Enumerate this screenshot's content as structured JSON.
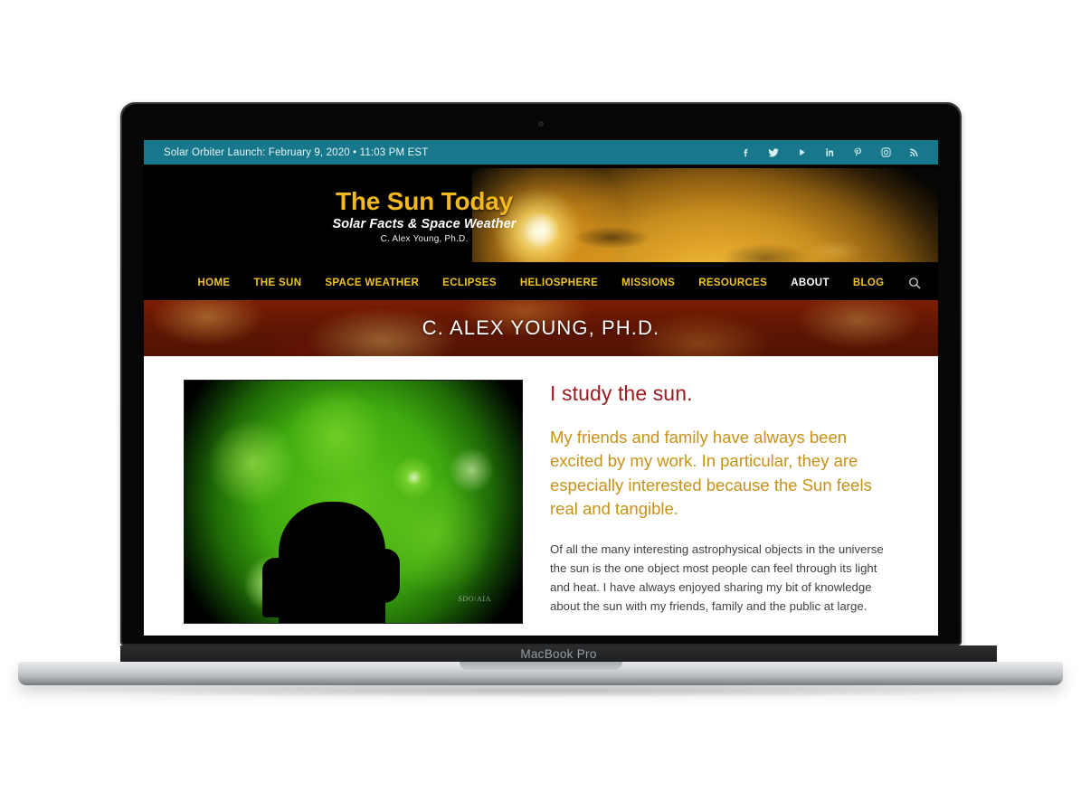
{
  "device": {
    "model_label": "MacBook Pro"
  },
  "topbar": {
    "announcement": "Solar Orbiter Launch: February 9, 2020 • 11:03 PM EST",
    "background_color": "#16788a",
    "social": [
      {
        "name": "facebook",
        "glyph": "f"
      },
      {
        "name": "twitter",
        "glyph": "bird"
      },
      {
        "name": "youtube",
        "glyph": "play"
      },
      {
        "name": "linkedin",
        "glyph": "in"
      },
      {
        "name": "pinterest",
        "glyph": "P"
      },
      {
        "name": "instagram",
        "glyph": "camera"
      },
      {
        "name": "rss",
        "glyph": "rss"
      }
    ]
  },
  "header": {
    "logo_title": "The Sun Today",
    "logo_tagline": "Solar Facts & Space Weather",
    "logo_author": "C. Alex Young, Ph.D.",
    "logo_title_color": "#f3b81e",
    "banner_image_alt": "sun-limb-with-solar-flare"
  },
  "nav": {
    "items": [
      {
        "label": "HOME",
        "active": false
      },
      {
        "label": "THE SUN",
        "active": false
      },
      {
        "label": "SPACE WEATHER",
        "active": false
      },
      {
        "label": "ECLIPSES",
        "active": false
      },
      {
        "label": "HELIOSPHERE",
        "active": false
      },
      {
        "label": "MISSIONS",
        "active": false
      },
      {
        "label": "RESOURCES",
        "active": false
      },
      {
        "label": "ABOUT",
        "active": true
      },
      {
        "label": "BLOG",
        "active": false
      }
    ],
    "link_color": "#efc327",
    "active_color": "#ffffff",
    "search_icon": "search-icon"
  },
  "page": {
    "title": "C. ALEX YOUNG, PH.D."
  },
  "main": {
    "figure": {
      "alt": "silhouette-of-man-in-front-of-green-solar-disk",
      "watermark": "SDO/AIA"
    },
    "heading": "I study the sun.",
    "heading_color": "#9c1b21",
    "lead": "My friends and family have always been excited by my work. In particular, they are especially interested because the Sun feels real and tangible.",
    "lead_color": "#c89118",
    "body": "Of all the many interesting astrophysical objects in the universe the sun is the one object most people can feel through its light and heat. I have always enjoyed sharing my bit of knowledge about the sun with my friends, family and the public at large."
  }
}
